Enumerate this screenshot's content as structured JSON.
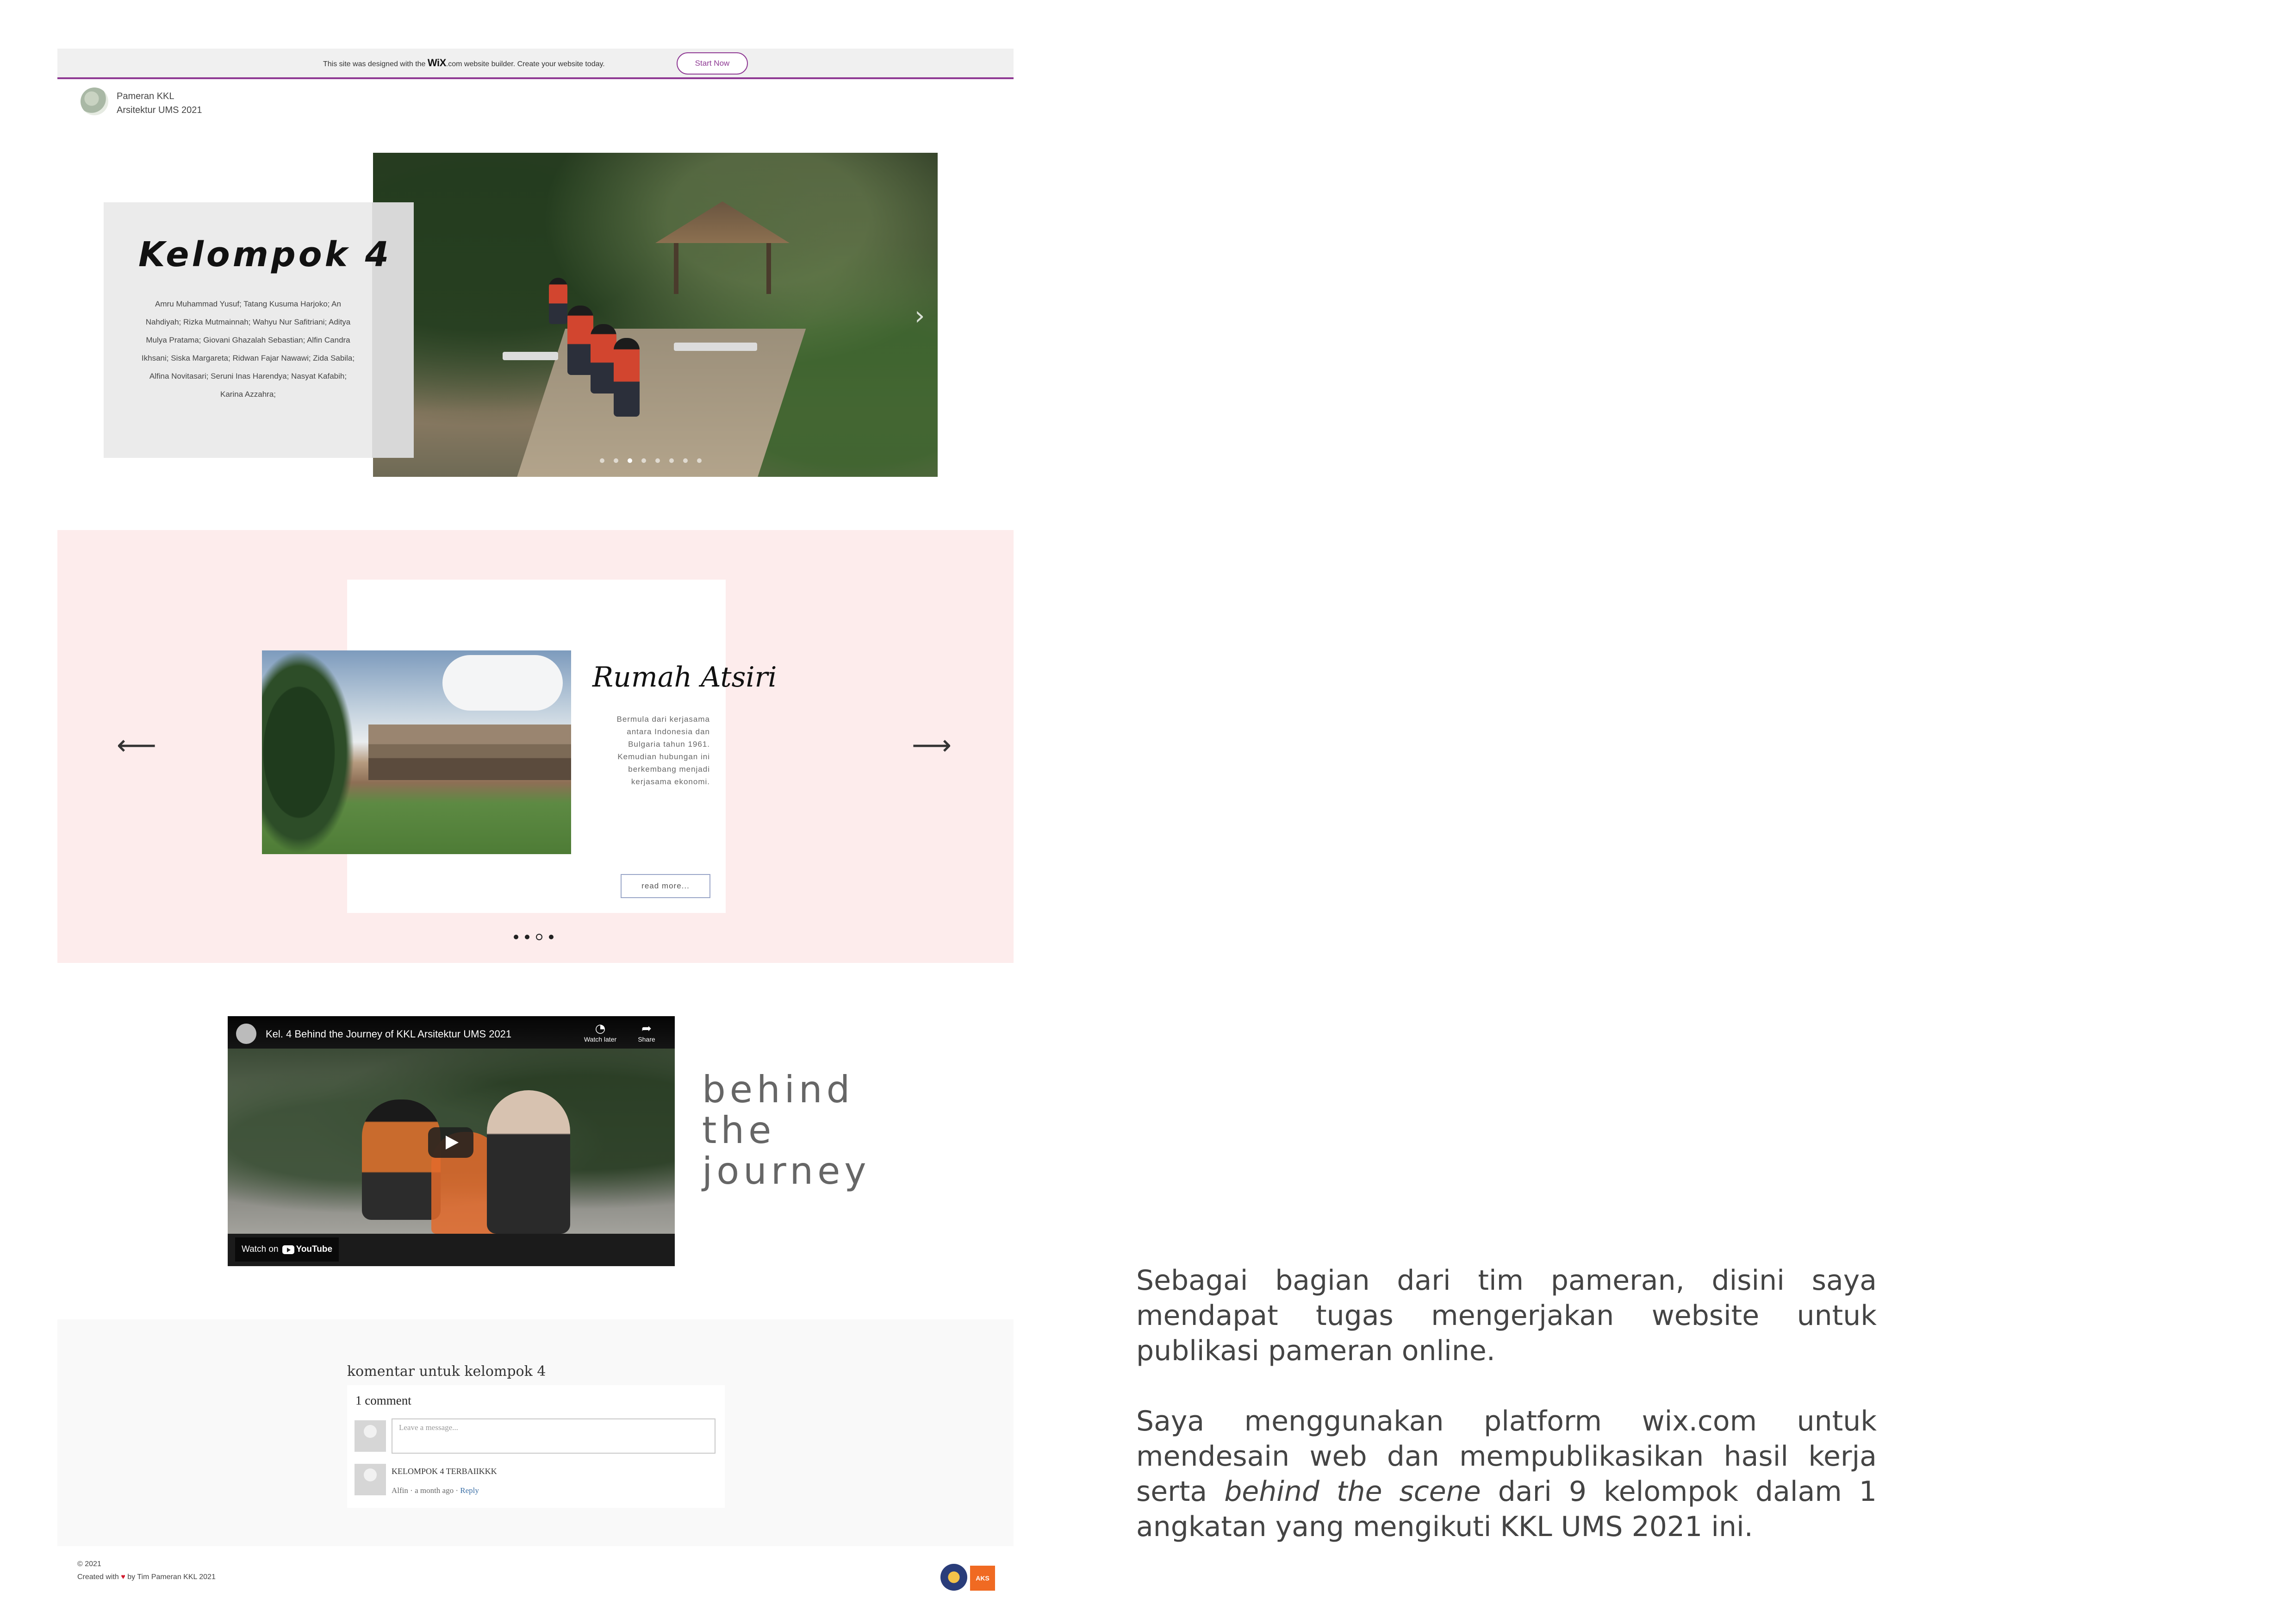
{
  "wix_banner": {
    "message_prefix": "This site was designed with the",
    "brand": "WiX",
    "message_suffix": ".com website builder. Create your website today.",
    "start_button": "Start Now"
  },
  "site": {
    "name_line1": "Pameran KKL",
    "name_line2": "Arsitektur UMS 2021"
  },
  "hero": {
    "title": "Kelompok 4",
    "members": "Amru Muhammad Yusuf; Tatang Kusuma Harjoko; An Nahdiyah; Rizka Mutmainnah; Wahyu Nur Safitriani; Aditya Mulya Pratama; Giovani Ghazalah Sebastian; Alfin Candra Ikhsani; Siska Margareta; Ridwan Fajar Nawawi; Zida Sabila; Alfina Novitasari; Seruni Inas Harendya; Nasyat Kafabih; Karina Azzahra;",
    "prev_arrow": "‹",
    "next_arrow": "›",
    "slide_count": 8,
    "active_slide": 2
  },
  "slider": {
    "title": "Rumah Atsiri",
    "description": "Bermula dari kerjasama antara Indonesia dan Bulgaria tahun 1961. Kemudian hubungan ini berkembang menjadi kerjasama ekonomi.",
    "read_more": "read more...",
    "prev_arrow": "⟵",
    "next_arrow": "⟶",
    "dot_count": 4,
    "active_dot": 3
  },
  "video": {
    "title": "Kel. 4 Behind the Journey of KKL Arsitektur UMS 2021",
    "watch_later": "Watch later",
    "share": "Share",
    "watch_on": "Watch on",
    "youtube": "YouTube"
  },
  "journey_text": [
    "behind",
    "the",
    "journey"
  ],
  "comments": {
    "section_title": "komentar untuk kelompok 4",
    "count_label": "1 comment",
    "input_placeholder": "Leave a message...",
    "items": [
      {
        "text": "KELOMPOK 4 TERBAIIKKK",
        "author": "Alfin",
        "age": "a month ago",
        "reply": "Reply"
      }
    ]
  },
  "footer": {
    "copyright": "© 2021",
    "credit_prefix": "Created with",
    "credit_suffix": "by Tim Pameran KKL 2021",
    "badge_text": "AKS UMS"
  },
  "description": {
    "paragraph1": "Sebagai bagian dari tim pameran, disini saya mendapat tugas mengerjakan website untuk publikasi pameran online.",
    "paragraph2_before": "Saya menggunakan platform wix.com untuk mendesain web dan mempublikasikan hasil kerja serta",
    "paragraph2_italic": "behind the scene",
    "paragraph2_after": "dari 9 kelompok dalam 1 angkatan yang mengikuti KKL UMS 2021 ini."
  },
  "colors": {
    "wix_accent": "#8f3a94",
    "pink_section": "#fdecec",
    "heart": "#d2182c"
  }
}
